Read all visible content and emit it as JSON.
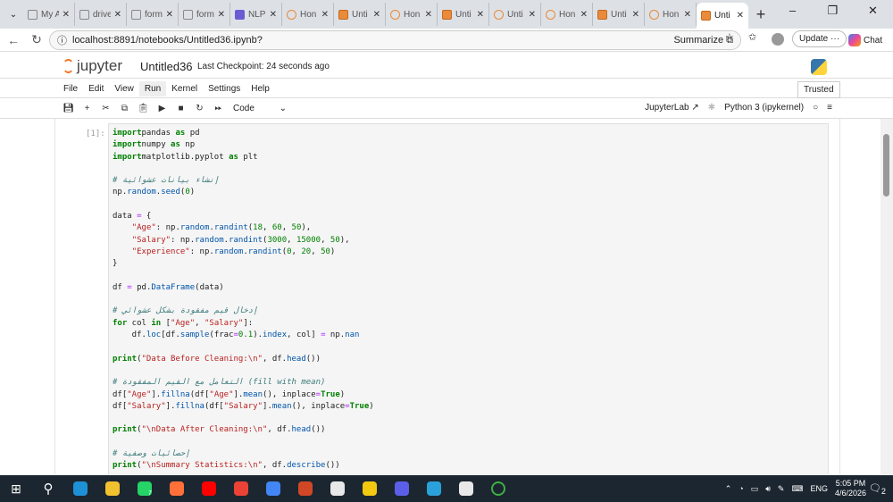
{
  "browser": {
    "tabs": [
      {
        "label": "My A",
        "icon": "globe"
      },
      {
        "label": "drive",
        "icon": "doc"
      },
      {
        "label": "form",
        "icon": "doc"
      },
      {
        "label": "form",
        "icon": "doc"
      },
      {
        "label": "NLP",
        "icon": "form"
      },
      {
        "label": "Hon",
        "icon": "jupyter"
      },
      {
        "label": "Unti",
        "icon": "notebook"
      },
      {
        "label": "Hon",
        "icon": "jupyter"
      },
      {
        "label": "Unti",
        "icon": "notebook"
      },
      {
        "label": "Unti",
        "icon": "jupyter"
      },
      {
        "label": "Hon",
        "icon": "jupyter"
      },
      {
        "label": "Unti",
        "icon": "notebook"
      },
      {
        "label": "Hon",
        "icon": "jupyter"
      },
      {
        "label": "Unti",
        "icon": "notebook",
        "active": true
      }
    ],
    "url": "localhost:8891/notebooks/Untitled36.ipynb?",
    "summarize": "Summarize",
    "update": "Update",
    "chat": "Chat"
  },
  "jupyter": {
    "logo": "jupyter",
    "notebook_title": "Untitled36",
    "checkpoint": "Last Checkpoint: 24 seconds ago",
    "menu": [
      "File",
      "Edit",
      "View",
      "Run",
      "Kernel",
      "Settings",
      "Help"
    ],
    "active_menu": "Run",
    "trusted": "Trusted",
    "cell_type": "Code",
    "jupyterlab": "JupyterLab",
    "kernel": "Python 3 (ipykernel)"
  },
  "cell": {
    "prompt": "[1]:",
    "lines": [
      [
        [
          "kw",
          "import"
        ],
        [
          "",
          "pandas "
        ],
        [
          "kw",
          "as"
        ],
        [
          "",
          " pd"
        ]
      ],
      [
        [
          "kw",
          "import"
        ],
        [
          "",
          "numpy "
        ],
        [
          "kw",
          "as"
        ],
        [
          "",
          " np"
        ]
      ],
      [
        [
          "kw",
          "import"
        ],
        [
          "",
          "matplotlib.pyplot "
        ],
        [
          "kw",
          "as"
        ],
        [
          "",
          " plt"
        ]
      ],
      [],
      [
        [
          "cm",
          "# إنشاء بيانات عشوائية"
        ]
      ],
      [
        [
          "",
          "np."
        ],
        [
          "fn",
          "random"
        ],
        [
          "",
          "."
        ],
        [
          "fn",
          "seed"
        ],
        [
          "",
          "("
        ],
        [
          "num",
          "0"
        ],
        [
          "",
          ")"
        ]
      ],
      [],
      [
        [
          "",
          "data "
        ],
        [
          "op",
          "="
        ],
        [
          "",
          " {"
        ]
      ],
      [
        [
          "",
          "    "
        ],
        [
          "str",
          "\"Age\""
        ],
        [
          "",
          ": np."
        ],
        [
          "fn",
          "random"
        ],
        [
          "",
          "."
        ],
        [
          "fn",
          "randint"
        ],
        [
          "",
          "("
        ],
        [
          "num",
          "18"
        ],
        [
          "",
          ", "
        ],
        [
          "num",
          "60"
        ],
        [
          "",
          ", "
        ],
        [
          "num",
          "50"
        ],
        [
          "",
          "),"
        ]
      ],
      [
        [
          "",
          "    "
        ],
        [
          "str",
          "\"Salary\""
        ],
        [
          "",
          ": np."
        ],
        [
          "fn",
          "random"
        ],
        [
          "",
          "."
        ],
        [
          "fn",
          "randint"
        ],
        [
          "",
          "("
        ],
        [
          "num",
          "3000"
        ],
        [
          "",
          ", "
        ],
        [
          "num",
          "15000"
        ],
        [
          "",
          ", "
        ],
        [
          "num",
          "50"
        ],
        [
          "",
          "),"
        ]
      ],
      [
        [
          "",
          "    "
        ],
        [
          "str",
          "\"Experience\""
        ],
        [
          "",
          ": np."
        ],
        [
          "fn",
          "random"
        ],
        [
          "",
          "."
        ],
        [
          "fn",
          "randint"
        ],
        [
          "",
          "("
        ],
        [
          "num",
          "0"
        ],
        [
          "",
          ", "
        ],
        [
          "num",
          "20"
        ],
        [
          "",
          ", "
        ],
        [
          "num",
          "50"
        ],
        [
          "",
          ")"
        ]
      ],
      [
        [
          "",
          "}"
        ]
      ],
      [],
      [
        [
          "",
          "df "
        ],
        [
          "op",
          "="
        ],
        [
          "",
          " pd."
        ],
        [
          "fn",
          "DataFrame"
        ],
        [
          "",
          "(data)"
        ]
      ],
      [],
      [
        [
          "cm",
          "# إدخال قيم مفقودة بشكل عشوائي"
        ]
      ],
      [
        [
          "kw",
          "for"
        ],
        [
          "",
          " col "
        ],
        [
          "kw",
          "in"
        ],
        [
          "",
          " ["
        ],
        [
          "str",
          "\"Age\""
        ],
        [
          "",
          ", "
        ],
        [
          "str",
          "\"Salary\""
        ],
        [
          "",
          "]:"
        ]
      ],
      [
        [
          "",
          "    df."
        ],
        [
          "fn",
          "loc"
        ],
        [
          "",
          "[df."
        ],
        [
          "fn",
          "sample"
        ],
        [
          "",
          "(frac"
        ],
        [
          "op",
          "="
        ],
        [
          "num",
          "0.1"
        ],
        [
          "",
          ")."
        ],
        [
          "fn",
          "index"
        ],
        [
          "",
          ", col] "
        ],
        [
          "op",
          "="
        ],
        [
          "",
          " np."
        ],
        [
          "fn",
          "nan"
        ]
      ],
      [],
      [
        [
          "kw",
          "print"
        ],
        [
          "",
          "("
        ],
        [
          "str",
          "\"Data Before Cleaning:\\n\""
        ],
        [
          "",
          ", df."
        ],
        [
          "fn",
          "head"
        ],
        [
          "",
          "())"
        ]
      ],
      [],
      [
        [
          "cm",
          "# التعامل مع القيم المفقودة (fill with mean)"
        ]
      ],
      [
        [
          "",
          "df["
        ],
        [
          "str",
          "\"Age\""
        ],
        [
          "",
          "]."
        ],
        [
          "fn",
          "fillna"
        ],
        [
          "",
          "(df["
        ],
        [
          "str",
          "\"Age\""
        ],
        [
          "",
          "]."
        ],
        [
          "fn",
          "mean"
        ],
        [
          "",
          "(), inplace"
        ],
        [
          "op",
          "="
        ],
        [
          "kw",
          "True"
        ],
        [
          "",
          ")"
        ]
      ],
      [
        [
          "",
          "df["
        ],
        [
          "str",
          "\"Salary\""
        ],
        [
          "",
          "]."
        ],
        [
          "fn",
          "fillna"
        ],
        [
          "",
          "(df["
        ],
        [
          "str",
          "\"Salary\""
        ],
        [
          "",
          "]."
        ],
        [
          "fn",
          "mean"
        ],
        [
          "",
          "(), inplace"
        ],
        [
          "op",
          "="
        ],
        [
          "kw",
          "True"
        ],
        [
          "",
          ")"
        ]
      ],
      [],
      [
        [
          "kw",
          "print"
        ],
        [
          "",
          "("
        ],
        [
          "str",
          "\"\\nData After Cleaning:\\n\""
        ],
        [
          "",
          ", df."
        ],
        [
          "fn",
          "head"
        ],
        [
          "",
          "())"
        ]
      ],
      [],
      [
        [
          "cm",
          "# إحصائيات وصفية"
        ]
      ],
      [
        [
          "kw",
          "print"
        ],
        [
          "",
          "("
        ],
        [
          "str",
          "\"\\nSummary Statistics:\\n\""
        ],
        [
          "",
          ", df."
        ],
        [
          "fn",
          "describe"
        ],
        [
          "",
          "())"
        ]
      ]
    ]
  },
  "taskbar": {
    "apps": [
      {
        "name": "edge",
        "color": "#1e90d6"
      },
      {
        "name": "file-explorer",
        "color": "#f2c130"
      },
      {
        "name": "whatsapp",
        "color": "#25d366",
        "badge": "7"
      },
      {
        "name": "firefox",
        "color": "#ff7139"
      },
      {
        "name": "youtube",
        "color": "#ff0000"
      },
      {
        "name": "gmail",
        "color": "#ea4335"
      },
      {
        "name": "chrome",
        "color": "#4285f4"
      },
      {
        "name": "powerpoint",
        "color": "#d24726"
      },
      {
        "name": "chatgpt",
        "color": "#e8e8e8"
      },
      {
        "name": "power-bi",
        "color": "#f2c811"
      },
      {
        "name": "copilot",
        "color": "#5b5fe8"
      },
      {
        "name": "telegram",
        "color": "#2aa1da"
      },
      {
        "name": "settings",
        "color": "#e8e8e8"
      },
      {
        "name": "jupyter-loading",
        "color": "#3cb043"
      }
    ],
    "language": "ENG",
    "time": "5:05 PM",
    "date": "4/6/2026",
    "notifications": "2"
  }
}
